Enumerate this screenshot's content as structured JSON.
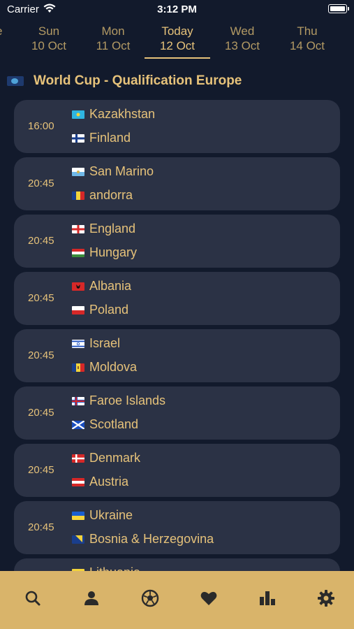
{
  "status_bar": {
    "carrier": "Carrier",
    "time": "3:12 PM"
  },
  "date_strip": {
    "partial_left": "e",
    "days": [
      {
        "day": "Sun",
        "date": "10 Oct"
      },
      {
        "day": "Mon",
        "date": "11 Oct"
      },
      {
        "day": "Today",
        "date": "12 Oct"
      },
      {
        "day": "Wed",
        "date": "13 Oct"
      },
      {
        "day": "Thu",
        "date": "14 Oct"
      }
    ],
    "selected": "Today"
  },
  "league": {
    "name": "World Cup - Qualification Europe",
    "icon": "world-cup-flag-icon"
  },
  "matches": [
    {
      "time": "16:00",
      "home": "Kazakhstan",
      "away": "Finland"
    },
    {
      "time": "20:45",
      "home": "San Marino",
      "away": "andorra"
    },
    {
      "time": "20:45",
      "home": "England",
      "away": "Hungary"
    },
    {
      "time": "20:45",
      "home": "Albania",
      "away": "Poland"
    },
    {
      "time": "20:45",
      "home": "Israel",
      "away": "Moldova"
    },
    {
      "time": "20:45",
      "home": "Faroe Islands",
      "away": "Scotland"
    },
    {
      "time": "20:45",
      "home": "Denmark",
      "away": "Austria"
    },
    {
      "time": "20:45",
      "home": "Ukraine",
      "away": "Bosnia & Herzegovina"
    },
    {
      "time": "",
      "home": "Lithuania",
      "away": ""
    }
  ],
  "tab_bar": {
    "tabs": [
      "search-icon",
      "profile-icon",
      "football-icon",
      "heart-icon",
      "stats-icon",
      "settings-icon"
    ],
    "selected": "football-icon"
  },
  "colors": {
    "background": "#121a2c",
    "card": "#2b3245",
    "accent": "#e6c27a",
    "tab_bar": "#d9b46a",
    "tab_icon": "#2a2a2a"
  }
}
